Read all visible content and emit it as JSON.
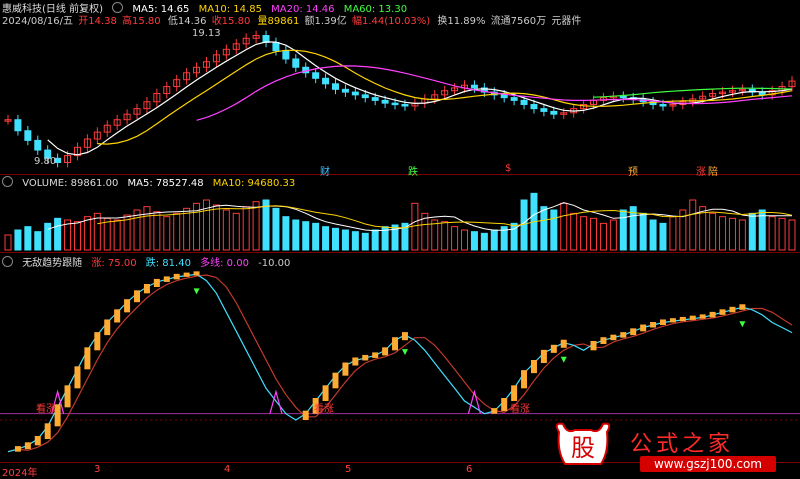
{
  "header": {
    "title": "惠威科技(日线 前复权)",
    "ma": [
      {
        "label": "MA5: 14.65",
        "color": "#ffffff"
      },
      {
        "label": "MA10: 14.85",
        "color": "#ffd400"
      },
      {
        "label": "MA20: 14.46",
        "color": "#ff40ff"
      },
      {
        "label": "MA60: 13.30",
        "color": "#40ff40"
      }
    ]
  },
  "info_line": {
    "date": "2024/08/16/五",
    "open": "开14.38",
    "high": "高15.80",
    "low": "低14.36",
    "close": "收15.80",
    "vol": "量89861",
    "amount": "额1.39亿",
    "change": "幅1.44(10.03%)",
    "turnover": "换11.89%",
    "float": "流通7560万",
    "unit": "元器件"
  },
  "price_annotations": {
    "high": "19.13",
    "low": "9.80"
  },
  "signal_labels": [
    "财",
    "跌",
    "$",
    "预",
    "涨",
    "陪"
  ],
  "volume_header": {
    "title": "VOLUME: 89861.00",
    "ma5": "MA5: 78527.48",
    "ma10": "MA10: 94680.33"
  },
  "indicator_header": {
    "name": "无敌趋势跟随",
    "up": "涨: 75.00",
    "down": "跌: 81.40",
    "multi": "多线: 0.00",
    "ref": "-10.00"
  },
  "indicator_labels": [
    "看涨",
    "看涨",
    "看涨"
  ],
  "x_axis": [
    "2024年",
    "3",
    "4",
    "5",
    "6"
  ],
  "watermark": {
    "logo": "股",
    "text": "公式之家",
    "url": "www.gszj100.com"
  },
  "colors": {
    "up": "#ff3b3b",
    "down": "#40e0ff",
    "ma5": "#ffffff",
    "ma10": "#ffd400",
    "ma20": "#ff40ff",
    "ma60": "#40ff40",
    "bull": "#ffaa33",
    "grid": "#7a0000"
  },
  "chart_data": {
    "type": "line",
    "close_series": [
      13.0,
      12.2,
      11.5,
      10.8,
      10.2,
      9.9,
      10.4,
      11.0,
      11.6,
      12.1,
      12.6,
      13.0,
      13.4,
      13.8,
      14.3,
      14.9,
      15.4,
      15.9,
      16.4,
      16.8,
      17.2,
      17.7,
      18.1,
      18.5,
      18.9,
      19.1,
      18.6,
      18.0,
      17.4,
      16.8,
      16.4,
      16.0,
      15.6,
      15.2,
      15.0,
      14.8,
      14.6,
      14.4,
      14.2,
      14.1,
      14.0,
      14.2,
      14.5,
      14.8,
      15.1,
      15.3,
      15.5,
      15.3,
      15.0,
      14.8,
      14.6,
      14.4,
      14.1,
      13.8,
      13.6,
      13.4,
      13.5,
      13.8,
      14.1,
      14.4,
      14.6,
      14.7,
      14.6,
      14.5,
      14.3,
      14.1,
      14.0,
      14.1,
      14.3,
      14.5,
      14.7,
      14.9,
      15.0,
      15.1,
      15.2,
      15.0,
      14.8,
      15.1,
      15.4,
      15.8
    ],
    "volume_series": [
      45,
      60,
      70,
      55,
      80,
      95,
      90,
      85,
      100,
      110,
      95,
      90,
      105,
      120,
      130,
      115,
      100,
      110,
      125,
      140,
      150,
      135,
      120,
      110,
      130,
      145,
      150,
      125,
      100,
      90,
      85,
      80,
      70,
      65,
      60,
      55,
      50,
      60,
      70,
      75,
      80,
      140,
      110,
      90,
      85,
      70,
      60,
      55,
      50,
      60,
      70,
      80,
      150,
      170,
      130,
      120,
      140,
      110,
      100,
      95,
      80,
      90,
      120,
      130,
      110,
      90,
      80,
      100,
      120,
      150,
      130,
      110,
      100,
      95,
      90,
      110,
      120,
      100,
      95,
      90
    ],
    "indicator_series": [
      -40,
      -38,
      -35,
      -30,
      -20,
      -5,
      10,
      25,
      40,
      52,
      62,
      70,
      78,
      85,
      90,
      94,
      96,
      98,
      99,
      100,
      95,
      85,
      70,
      55,
      40,
      25,
      10,
      0,
      -10,
      -15,
      -10,
      0,
      10,
      20,
      28,
      32,
      34,
      36,
      40,
      48,
      52,
      48,
      40,
      30,
      20,
      10,
      0,
      -5,
      -10,
      -8,
      0,
      10,
      22,
      30,
      38,
      42,
      46,
      44,
      40,
      45,
      48,
      50,
      52,
      55,
      58,
      60,
      62,
      63,
      64,
      65,
      66,
      68,
      70,
      72,
      74,
      72,
      68,
      62,
      58,
      54
    ]
  }
}
